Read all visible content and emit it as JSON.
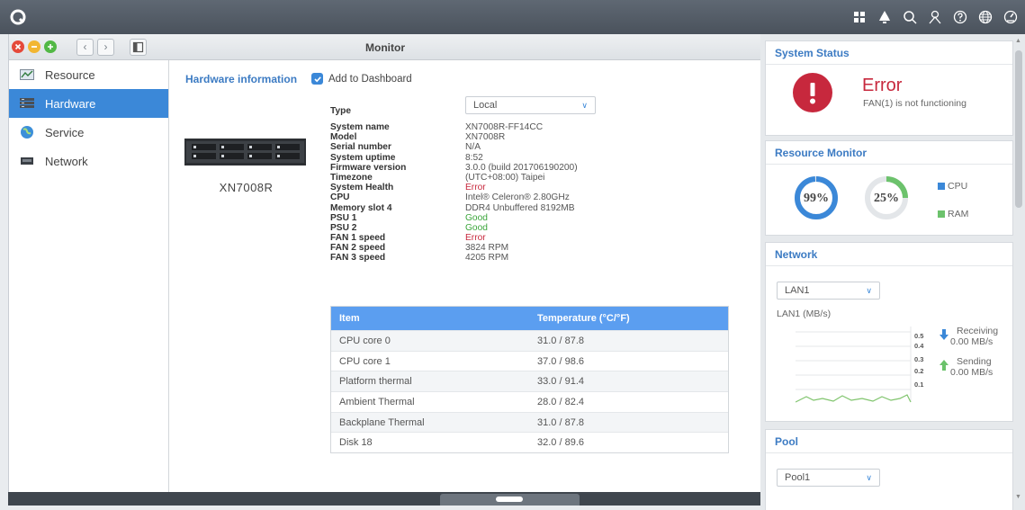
{
  "window": {
    "title": "Monitor"
  },
  "sidebar": {
    "items": [
      {
        "label": "Resource",
        "icon": "chart-icon"
      },
      {
        "label": "Hardware",
        "icon": "server-icon"
      },
      {
        "label": "Service",
        "icon": "globe-icon"
      },
      {
        "label": "Network",
        "icon": "network-card-icon"
      }
    ],
    "active": "Hardware"
  },
  "hardware": {
    "section_title": "Hardware information",
    "add_to_dashboard": "Add to Dashboard",
    "device_name": "XN7008R",
    "type_label": "Type",
    "type_value": "Local",
    "details": [
      {
        "key": "System name",
        "value": "XN7008R-FF14CC",
        "status": "normal"
      },
      {
        "key": "Model",
        "value": "XN7008R",
        "status": "normal"
      },
      {
        "key": "Serial number",
        "value": "N/A",
        "status": "normal"
      },
      {
        "key": "System uptime",
        "value": "8:52",
        "status": "normal"
      },
      {
        "key": "Firmware version",
        "value": "3.0.0 (build 201706190200)",
        "status": "normal"
      },
      {
        "key": "Timezone",
        "value": "(UTC+08:00) Taipei",
        "status": "normal"
      },
      {
        "key": "System Health",
        "value": "Error",
        "status": "error"
      },
      {
        "key": "CPU",
        "value": "Intel® Celeron® 2.80GHz",
        "status": "normal"
      },
      {
        "key": "Memory slot 4",
        "value": "DDR4 Unbuffered 8192MB",
        "status": "normal"
      },
      {
        "key": "PSU 1",
        "value": "Good",
        "status": "good"
      },
      {
        "key": "PSU 2",
        "value": "Good",
        "status": "good"
      },
      {
        "key": "FAN 1 speed",
        "value": "Error",
        "status": "error"
      },
      {
        "key": "FAN 2 speed",
        "value": "3824 RPM",
        "status": "normal"
      },
      {
        "key": "FAN 3 speed",
        "value": "4205 RPM",
        "status": "normal"
      }
    ],
    "temperature_table": {
      "headers": [
        "Item",
        "Temperature (°C/°F)"
      ],
      "rows": [
        [
          "CPU core 0",
          "31.0 / 87.8"
        ],
        [
          "CPU core 1",
          "37.0 / 98.6"
        ],
        [
          "Platform thermal",
          "33.0 / 91.4"
        ],
        [
          "Ambient Thermal",
          "28.0 / 82.4"
        ],
        [
          "Backplane Thermal",
          "31.0 / 87.8"
        ],
        [
          "Disk 18",
          "32.0 / 89.6"
        ]
      ]
    }
  },
  "widgets": {
    "system_status": {
      "title": "System Status",
      "status": "Error",
      "message": "FAN(1) is not functioning"
    },
    "resource_monitor": {
      "title": "Resource Monitor",
      "cpu_value": "99%",
      "cpu_fraction": 0.99,
      "ram_value": "25%",
      "ram_fraction": 0.25,
      "legend_cpu": "CPU",
      "legend_ram": "RAM"
    },
    "network": {
      "title": "Network",
      "interface": "LAN1",
      "unit_label": "LAN1 (MB/s)",
      "y_ticks": [
        "0.5",
        "0.4",
        "0.3",
        "0.2",
        "0.1"
      ],
      "receiving_label": "Receiving",
      "receiving_value": "0.00 MB/s",
      "sending_label": "Sending",
      "sending_value": "0.00 MB/s"
    },
    "pool": {
      "title": "Pool",
      "selected": "Pool1"
    }
  },
  "colors": {
    "accent": "#3b88d8",
    "error": "#c7283d",
    "good": "#3aa53a",
    "cpu": "#3b88d8",
    "ram": "#6cc26c"
  }
}
